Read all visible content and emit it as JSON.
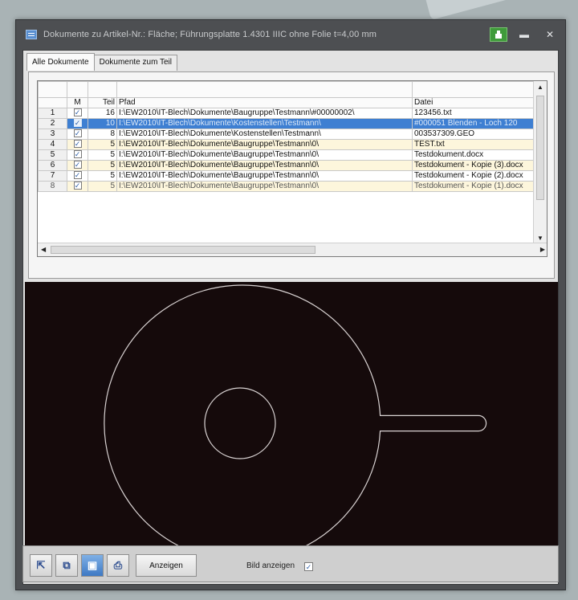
{
  "window": {
    "title": "Dokumente zu Artikel-Nr.: Fläche; Führungsplatte 1.4301 IIIC ohne Folie t=4,00 mm",
    "controls": {
      "minimize": "▬",
      "close": "✕"
    }
  },
  "tabs": [
    {
      "label": "Alle Dokumente",
      "active": true
    },
    {
      "label": "Dokumente zum Teil",
      "active": false
    }
  ],
  "grid": {
    "columns": {
      "m": "M",
      "teil": "Teil",
      "pfad": "Pfad",
      "datei": "Datei"
    },
    "rows": [
      {
        "n": "1",
        "m": "✓",
        "teil": "16",
        "pfad": "I:\\EW2010\\IT-Blech\\Dokumente\\Baugruppe\\Testmann\\#00000002\\",
        "datei": "123456.txt"
      },
      {
        "n": "2",
        "m": "✓",
        "teil": "10",
        "pfad": "I:\\EW2010\\IT-Blech\\Dokumente\\Kostenstellen\\Testmann\\",
        "datei": "#000051 Blenden - Loch 120"
      },
      {
        "n": "3",
        "m": "✓",
        "teil": "8",
        "pfad": "I:\\EW2010\\IT-Blech\\Dokumente\\Kostenstellen\\Testmann\\",
        "datei": "003537309.GEO"
      },
      {
        "n": "4",
        "m": "✓",
        "teil": "5",
        "pfad": "I:\\EW2010\\IT-Blech\\Dokumente\\Baugruppe\\Testmann\\0\\",
        "datei": "TEST.txt"
      },
      {
        "n": "5",
        "m": "✓",
        "teil": "5",
        "pfad": "I:\\EW2010\\IT-Blech\\Dokumente\\Baugruppe\\Testmann\\0\\",
        "datei": "Testdokument.docx"
      },
      {
        "n": "6",
        "m": "✓",
        "teil": "5",
        "pfad": "I:\\EW2010\\IT-Blech\\Dokumente\\Baugruppe\\Testmann\\0\\",
        "datei": "Testdokument - Kopie (3).docx"
      },
      {
        "n": "7",
        "m": "✓",
        "teil": "5",
        "pfad": "I:\\EW2010\\IT-Blech\\Dokumente\\Baugruppe\\Testmann\\0\\",
        "datei": "Testdokument - Kopie (2).docx"
      },
      {
        "n": "8",
        "m": "✓",
        "teil": "5",
        "pfad": "I:\\EW2010\\IT-Blech\\Dokumente\\Baugruppe\\Testmann\\0\\",
        "datei": "Testdokument - Kopie (1).docx"
      }
    ],
    "selected_row": 2
  },
  "preview": {
    "stroke_color": "#d8d2d2",
    "background": "#150a0b"
  },
  "bottom": {
    "buttons": [
      {
        "icon": "add-document-icon",
        "glyph": "⇱"
      },
      {
        "icon": "copy-document-icon",
        "glyph": "⧉"
      },
      {
        "icon": "monitor-icon",
        "glyph": "▣"
      },
      {
        "icon": "scanner-icon",
        "glyph": "⎙"
      }
    ],
    "anzeigen_label": "Anzeigen",
    "bild_label": "Bild anzeigen",
    "bild_checked": "✓"
  },
  "colors": {
    "selection": "#3e7fd2",
    "alt_row": "#fdf6dc",
    "accent_green": "#3f9b3a"
  }
}
